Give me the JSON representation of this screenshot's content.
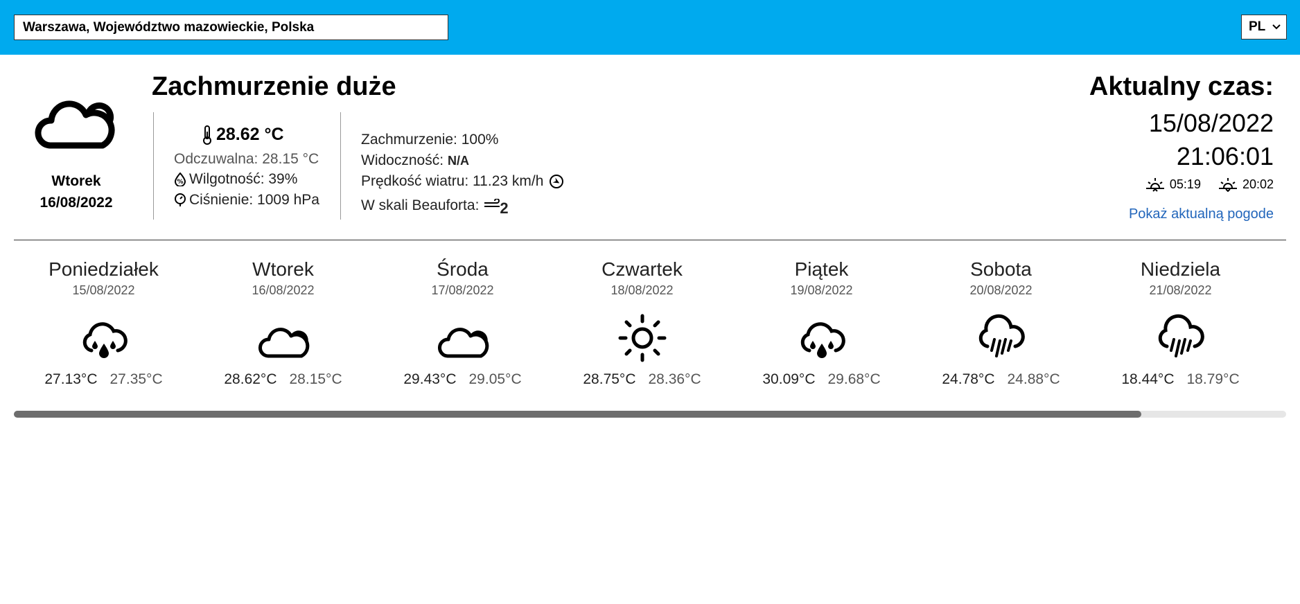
{
  "header": {
    "search_value": "Warszawa, Województwo mazowieckie, Polska",
    "language": "PL",
    "bar_color": "#00aaee"
  },
  "current": {
    "icon": "cloudy-icon",
    "day_name": "Wtorek",
    "day_date": "16/08/2022",
    "condition": "Zachmurzenie duże",
    "temperature": "28.62 °C",
    "feels_like": "Odczuwalna: 28.15 °C",
    "humidity": "Wilgotność: 39%",
    "pressure": "Ciśnienie: 1009 hPa",
    "cloudiness": "Zachmurzenie: 100%",
    "visibility_label": "Widoczność:",
    "visibility_value": "N/A",
    "wind_speed": "Prędkość wiatru: 11.23 km/h",
    "beaufort_label": "W skali Beauforta:",
    "beaufort_value": "2"
  },
  "time_panel": {
    "title": "Aktualny czas:",
    "date": "15/08/2022",
    "clock": "21:06:01",
    "sunrise": "05:19",
    "sunset": "20:02",
    "link": "Pokaż aktualną pogode"
  },
  "forecast": [
    {
      "day": "Poniedziałek",
      "date": "15/08/2022",
      "icon": "showers-icon",
      "high": "27.13°C",
      "low": "27.35°C"
    },
    {
      "day": "Wtorek",
      "date": "16/08/2022",
      "icon": "cloudy-icon",
      "high": "28.62°C",
      "low": "28.15°C"
    },
    {
      "day": "Środa",
      "date": "17/08/2022",
      "icon": "cloudy-icon",
      "high": "29.43°C",
      "low": "29.05°C"
    },
    {
      "day": "Czwartek",
      "date": "18/08/2022",
      "icon": "sun-icon",
      "high": "28.75°C",
      "low": "28.36°C"
    },
    {
      "day": "Piątek",
      "date": "19/08/2022",
      "icon": "showers-icon",
      "high": "30.09°C",
      "low": "29.68°C"
    },
    {
      "day": "Sobota",
      "date": "20/08/2022",
      "icon": "rain-icon",
      "high": "24.78°C",
      "low": "24.88°C"
    },
    {
      "day": "Niedziela",
      "date": "21/08/2022",
      "icon": "rain-icon",
      "high": "18.44°C",
      "low": "18.79°C"
    }
  ],
  "scroll_position_fraction": 0.886
}
